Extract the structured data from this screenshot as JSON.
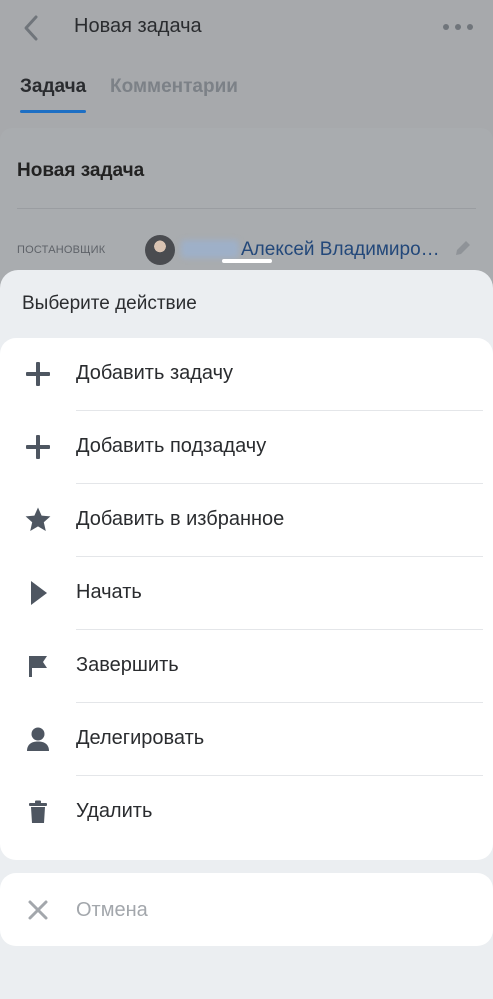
{
  "header": {
    "title": "Новая задача",
    "back_icon": "chevron-left-icon",
    "more_icon": "more-horizontal-icon"
  },
  "tabs": [
    {
      "label": "Задача",
      "active": true
    },
    {
      "label": "Комментарии",
      "active": false
    }
  ],
  "task_card": {
    "title": "Новая задача",
    "field_label": "ПОСТАНОВЩИК",
    "person_name": "Алексей Владимиро…",
    "edit_icon": "pencil-icon"
  },
  "action_sheet": {
    "header": "Выберите действие",
    "items": [
      {
        "label": "Добавить задачу",
        "icon": "plus-icon"
      },
      {
        "label": "Добавить подзадачу",
        "icon": "plus-icon"
      },
      {
        "label": "Добавить в избранное",
        "icon": "star-icon"
      },
      {
        "label": "Начать",
        "icon": "play-icon"
      },
      {
        "label": "Завершить",
        "icon": "flag-icon"
      },
      {
        "label": "Делегировать",
        "icon": "person-icon"
      },
      {
        "label": "Удалить",
        "icon": "trash-icon"
      }
    ],
    "cancel_label": "Отмена",
    "cancel_icon": "close-icon"
  },
  "colors": {
    "accent": "#1d6fc4",
    "icon": "#4e5661",
    "overlay": "#a7a9ac"
  }
}
